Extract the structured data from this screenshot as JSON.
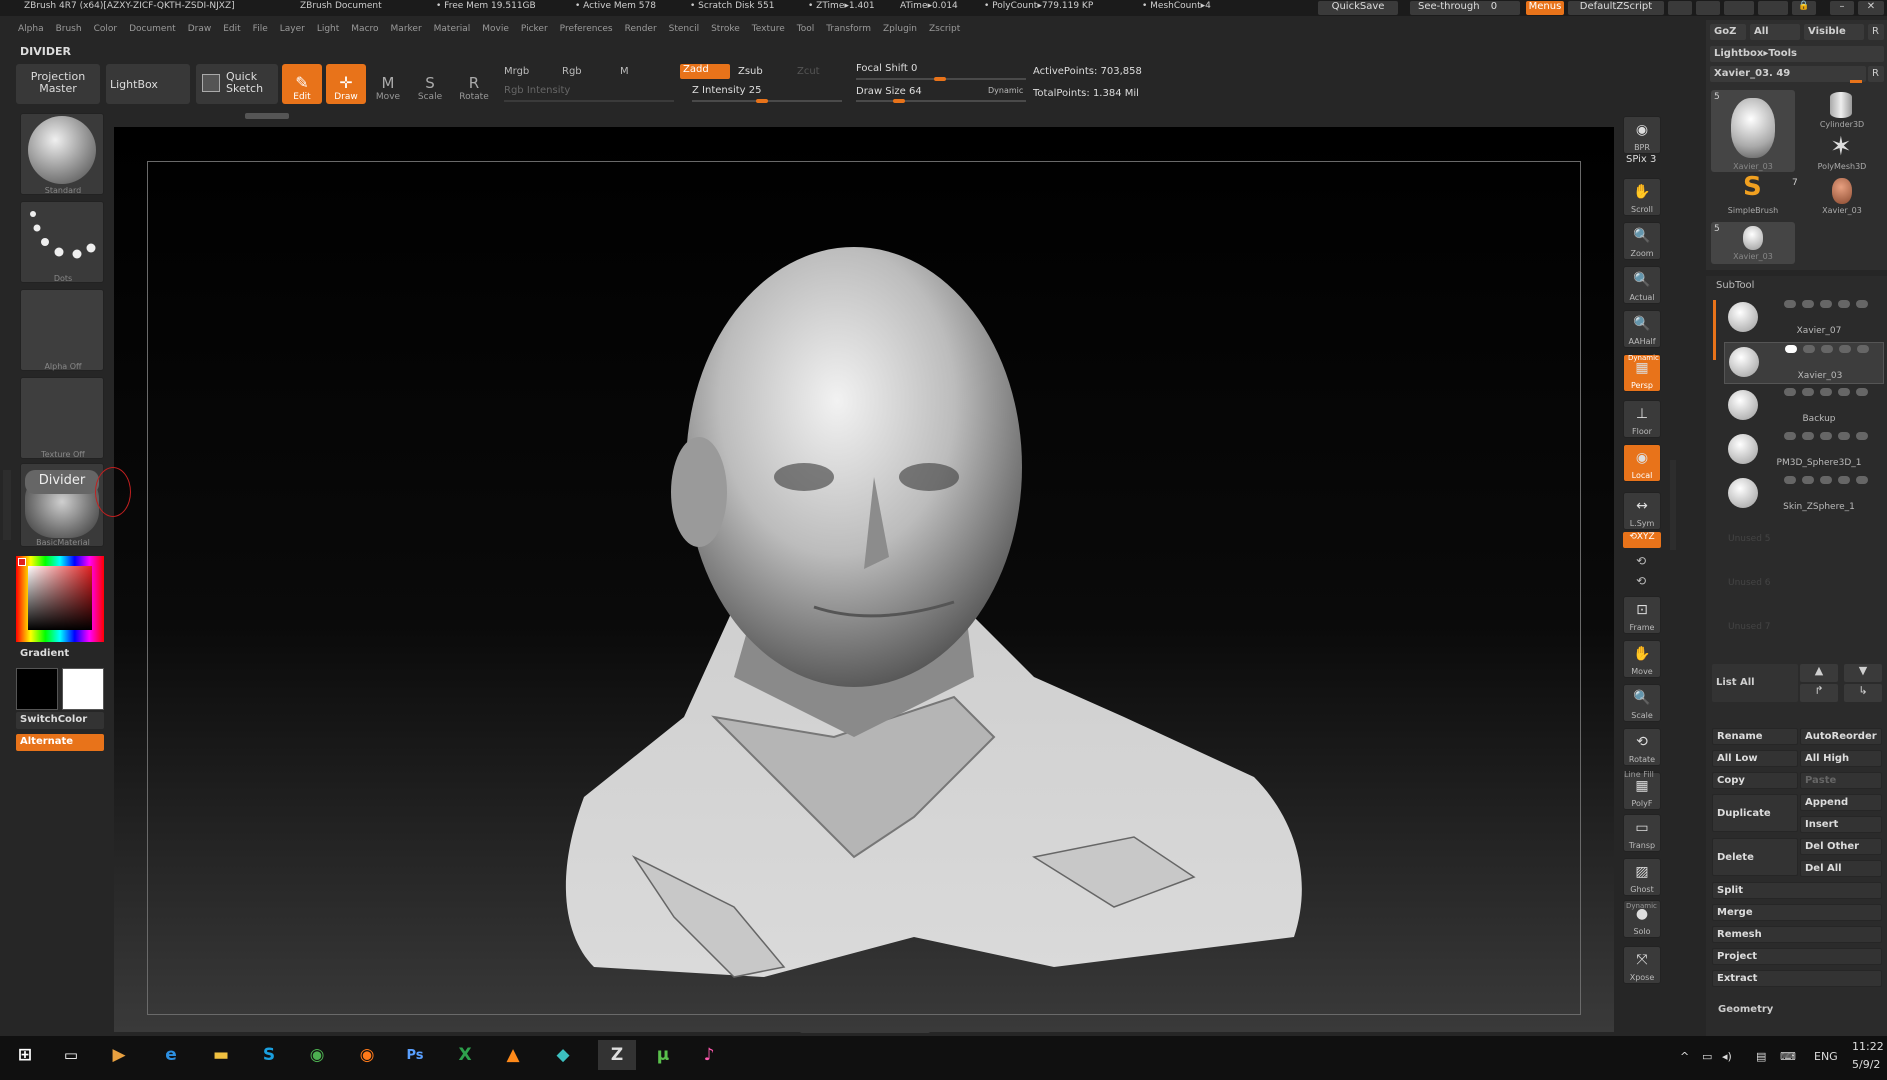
{
  "titlebar": {
    "app": "ZBrush 4R7 (x64)[AZXY-ZICF-QKTH-ZSDI-NJXZ]",
    "doc": "ZBrush Document",
    "free_mem": "• Free Mem 19.511GB",
    "active_mem": "• Active Mem 578",
    "scratch": "• Scratch Disk 551",
    "ztime": "• ZTime▸1.401",
    "atime": "ATime▸0.014",
    "polycount": "• PolyCount▸779.119 KP",
    "meshcount": "• MeshCount▸4",
    "quicksave": "QuickSave",
    "seethrough": "See-through",
    "seethrough_val": "0",
    "menus": "Menus",
    "script": "DefaultZScript"
  },
  "menubar": [
    "Alpha",
    "Brush",
    "Color",
    "Document",
    "Draw",
    "Edit",
    "File",
    "Layer",
    "Light",
    "Macro",
    "Marker",
    "Material",
    "Movie",
    "Picker",
    "Preferences",
    "Render",
    "Stencil",
    "Stroke",
    "Texture",
    "Tool",
    "Transform",
    "Zplugin",
    "Zscript"
  ],
  "current_tool_label": "DIVIDER",
  "toolbar": {
    "projection_master_1": "Projection",
    "projection_master_2": "Master",
    "lightbox": "LightBox",
    "quick_sketch_1": "Quick",
    "quick_sketch_2": "Sketch",
    "edit": "Edit",
    "draw": "Draw",
    "move": "Move",
    "scale": "Scale",
    "rotate": "Rotate",
    "mrgb": "Mrgb",
    "rgb": "Rgb",
    "m": "M",
    "rgb_intensity": "Rgb Intensity",
    "zadd": "Zadd",
    "zsub": "Zsub",
    "zcut": "Zcut",
    "z_intensity": "Z Intensity 25",
    "focal_shift": "Focal Shift 0",
    "draw_size": "Draw Size 64",
    "dynamic": "Dynamic",
    "active_points": "ActivePoints: 703,858",
    "total_points": "TotalPoints: 1.384 Mil"
  },
  "left_shelf": {
    "brush": "Standard",
    "stroke": "Dots",
    "alpha": "Alpha Off",
    "texture": "Texture Off",
    "material_title": "Divider",
    "material": "BasicMaterial",
    "gradient": "Gradient",
    "switchcolor": "SwitchColor",
    "alternate": "Alternate"
  },
  "right_shelf": {
    "bpr": "BPR",
    "spix": "SPix 3",
    "scroll": "Scroll",
    "zoom": "Zoom",
    "actual": "Actual",
    "aahalf": "AAHalf",
    "dynamic": "Dynamic",
    "persp": "Persp",
    "floor": "Floor",
    "local": "Local",
    "lsym": "L.Sym",
    "xyz": "⟲XYZ",
    "frame": "Frame",
    "move": "Move",
    "scale": "Scale",
    "rotate": "Rotate",
    "linefill": "Line Fill",
    "polyf": "PolyF",
    "transp": "Transp",
    "ghost": "Ghost",
    "dynamic2": "Dynamic",
    "solo": "Solo",
    "xpose": "Xpose"
  },
  "tool_panel": {
    "goz": "GoZ",
    "all": "All",
    "visible": "Visible",
    "r": "R",
    "lightbox_tools": "Lightbox▸Tools",
    "current_tool": "Xavier_03. 49",
    "thumbs": [
      {
        "label": "Xavier_03",
        "count": "5"
      },
      {
        "label": "Cylinder3D",
        "count": ""
      },
      {
        "label": "PolyMesh3D",
        "count": ""
      },
      {
        "label": "SimpleBrush",
        "count": ""
      },
      {
        "label": "Xavier_03",
        "count": "7"
      },
      {
        "label": "Xavier_03",
        "count": "5"
      }
    ]
  },
  "subtool": {
    "title": "SubTool",
    "items": [
      "Xavier_07",
      "Xavier_03",
      "Backup",
      "PM3D_Sphere3D_1",
      "Skin_ZSphere_1"
    ],
    "unused": [
      "Unused 5",
      "Unused 6",
      "Unused 7"
    ],
    "list_all": "List All",
    "rename": "Rename",
    "autoreorder": "AutoReorder",
    "all_low": "All Low",
    "all_high": "All High",
    "copy": "Copy",
    "paste": "Paste",
    "duplicate": "Duplicate",
    "append": "Append",
    "insert": "Insert",
    "delete": "Delete",
    "del_other": "Del Other",
    "del_all": "Del All",
    "split": "Split",
    "merge": "Merge",
    "remesh": "Remesh",
    "project": "Project",
    "extract": "Extract",
    "geometry": "Geometry"
  },
  "taskbar": {
    "lang": "ENG",
    "time": "11:22",
    "date": "5/9/2"
  },
  "colors": {
    "accent": "#e8731a",
    "panel": "#333333",
    "background": "#262626"
  }
}
